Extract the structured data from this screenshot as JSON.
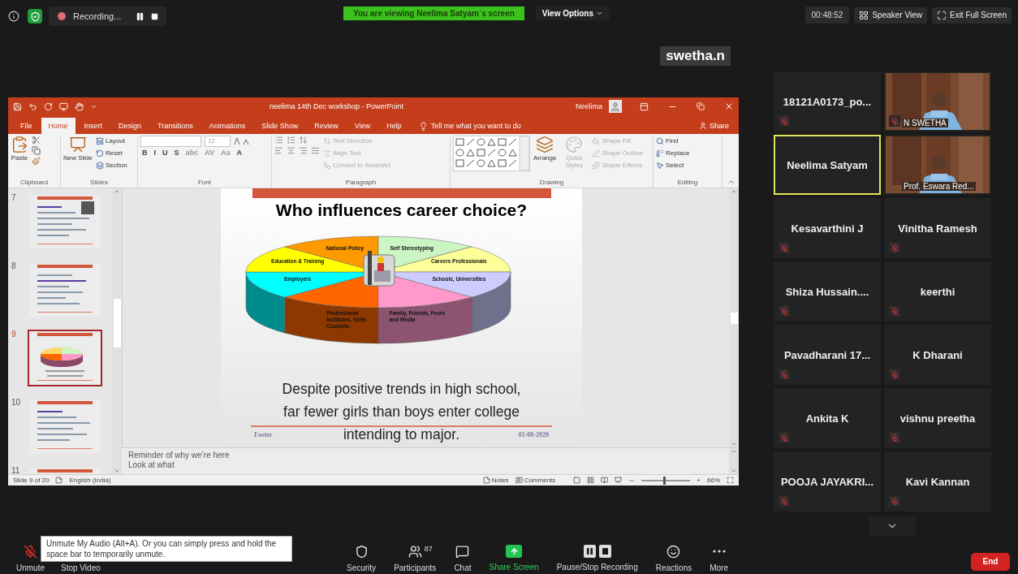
{
  "top_bar": {
    "recording_label": "Recording...",
    "viewing_banner": "You are viewing Neelima Satyam`s screen",
    "view_options": "View Options",
    "timer": "00:48:52",
    "speaker_view": "Speaker View",
    "exit_full_screen": "Exit Full Screen"
  },
  "presenter_label": "swetha.n",
  "powerpoint": {
    "title": "neelima 14th Dec workshop  -  PowerPoint",
    "user": "Neelima",
    "tabs": [
      {
        "label": "File",
        "selected": false
      },
      {
        "label": "Home",
        "selected": true
      },
      {
        "label": "Insert",
        "selected": false
      },
      {
        "label": "Design",
        "selected": false
      },
      {
        "label": "Transitions",
        "selected": false
      },
      {
        "label": "Animations",
        "selected": false
      },
      {
        "label": "Slide Show",
        "selected": false
      },
      {
        "label": "Review",
        "selected": false
      },
      {
        "label": "View",
        "selected": false
      },
      {
        "label": "Help",
        "selected": false
      }
    ],
    "tell_me": "Tell me what you want to do",
    "share": "Share",
    "ribbon_groups": [
      {
        "kind": "clipboard",
        "label": "Clipboard",
        "large": [
          {
            "label": "Paste",
            "disabled": false
          }
        ]
      },
      {
        "kind": "slides",
        "label": "Slides",
        "large": [
          {
            "label": "New Slide",
            "disabled": false
          }
        ],
        "small": [
          {
            "label": "Layout",
            "disabled": false
          },
          {
            "label": "Reset",
            "disabled": false
          },
          {
            "label": "Section",
            "disabled": false
          }
        ]
      },
      {
        "kind": "font",
        "label": "Font",
        "font_size": "12",
        "small": [
          {
            "label": "B",
            "disabled": false
          },
          {
            "label": "I",
            "disabled": false
          },
          {
            "label": "U",
            "disabled": false
          },
          {
            "label": "S",
            "disabled": false
          },
          {
            "label": "abc",
            "disabled": true
          },
          {
            "label": "AV",
            "disabled": true
          },
          {
            "label": "Aa",
            "disabled": true
          },
          {
            "label": "A",
            "disabled": false
          }
        ]
      },
      {
        "kind": "paragraph",
        "label": "Paragraph",
        "small": [
          {
            "label": "Text Direction",
            "disabled": true
          },
          {
            "label": "Align Text",
            "disabled": true
          },
          {
            "label": "Convert to SmartArt",
            "disabled": true
          }
        ]
      },
      {
        "kind": "drawing",
        "label": "Drawing",
        "large": [
          {
            "label": "Arrange",
            "disabled": false
          },
          {
            "label": "Quick Styles",
            "disabled": true
          }
        ],
        "small": [
          {
            "label": "Shape Fill",
            "disabled": true
          },
          {
            "label": "Shape Outline",
            "disabled": true
          },
          {
            "label": "Shape Effects",
            "disabled": true
          }
        ]
      },
      {
        "kind": "editing",
        "label": "Editing",
        "small": [
          {
            "label": "Find",
            "disabled": false
          },
          {
            "label": "Replace",
            "disabled": false
          },
          {
            "label": "Select",
            "disabled": false
          }
        ]
      }
    ],
    "thumbnails": [
      {
        "number": "7",
        "selected": false
      },
      {
        "number": "8",
        "selected": false
      },
      {
        "number": "9",
        "selected": true
      },
      {
        "number": "10",
        "selected": false
      },
      {
        "number": "11",
        "selected": false
      }
    ],
    "slide": {
      "title": "Who influences career choice?",
      "segments": [
        {
          "label": "Professional Institutes, Skills Councils",
          "color": "#ff6600"
        },
        {
          "label": "Employers",
          "color": "#00ffff"
        },
        {
          "label": "Education & Training",
          "color": "#ffff00"
        },
        {
          "label": "National Policy",
          "color": "#ff9900"
        },
        {
          "label": "Self Stereotyping",
          "color": "#ccf5c4"
        },
        {
          "label": "Careers Professionals",
          "color": "#ffff99"
        },
        {
          "label": "Schools,  Universities",
          "color": "#ccccff"
        },
        {
          "label": "Family, Friends, Peers and Media",
          "color": "#ff99cc"
        }
      ],
      "body": [
        "Despite positive trends in high school,",
        "far fewer girls than boys enter college",
        "intending to major."
      ],
      "footer": "Footer",
      "date": "01-08-2020"
    },
    "notes": [
      "Reminder of why we’re here",
      "Look at what"
    ],
    "status_bar": {
      "slide_count": "Slide 9 of 20",
      "language": "English (India)",
      "notes": "Notes",
      "comments": "Comments",
      "zoom_slider": {
        "level": 0.45
      },
      "zoom_in": "+",
      "zoom": "66%"
    }
  },
  "participants": [
    {
      "name": "18121A0173_po...",
      "kind": "name",
      "muted": true,
      "active_speaker": false
    },
    {
      "name": "N SWETHA",
      "kind": "video",
      "muted": true,
      "active_speaker": false
    },
    {
      "name": "Neelima Satyam",
      "kind": "name",
      "muted": false,
      "active_speaker": true
    },
    {
      "name": "Prof. Eswara Red...",
      "kind": "video",
      "muted": false,
      "active_speaker": false
    },
    {
      "name": "Kesavarthini J",
      "kind": "name",
      "muted": true,
      "active_speaker": false
    },
    {
      "name": "Vinitha Ramesh",
      "kind": "name",
      "muted": true,
      "active_speaker": false
    },
    {
      "name": "Shiza  Hussain....",
      "kind": "name",
      "muted": true,
      "active_speaker": false
    },
    {
      "name": "keerthi",
      "kind": "name",
      "muted": true,
      "active_speaker": false
    },
    {
      "name": "Pavadharani  17...",
      "kind": "name",
      "muted": true,
      "active_speaker": false
    },
    {
      "name": "K Dharani",
      "kind": "name",
      "muted": true,
      "active_speaker": false
    },
    {
      "name": "Ankita K",
      "kind": "name",
      "muted": true,
      "active_speaker": false
    },
    {
      "name": "vishnu preetha",
      "kind": "name",
      "muted": true,
      "active_speaker": false
    },
    {
      "name": "POOJA  JAYAKRI...",
      "kind": "name",
      "muted": true,
      "active_speaker": false
    },
    {
      "name": "Kavi Kannan",
      "kind": "name",
      "muted": true,
      "active_speaker": false
    }
  ],
  "tooltip": "Unmute My Audio (Alt+A). Or you can simply press and hold the space bar to temporarily unmute.",
  "toolbar": {
    "left": [
      {
        "kind": "unmute",
        "label": "Unmute"
      },
      {
        "kind": "stop_video",
        "label": "Stop Video"
      }
    ],
    "center": [
      {
        "kind": "security",
        "label": "Security"
      },
      {
        "kind": "participants",
        "label": "Participants",
        "count": "87"
      },
      {
        "kind": "chat",
        "label": "Chat"
      },
      {
        "kind": "share",
        "label": "Share Screen"
      },
      {
        "kind": "record",
        "label": "Pause/Stop Recording"
      },
      {
        "kind": "reactions",
        "label": "Reactions"
      },
      {
        "kind": "more",
        "label": "More"
      }
    ],
    "end": "End"
  }
}
